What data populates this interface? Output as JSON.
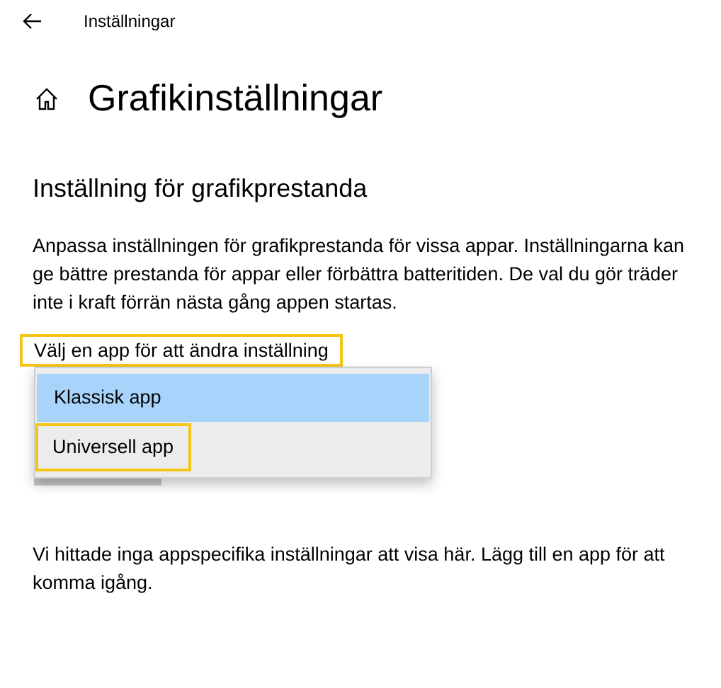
{
  "window": {
    "title": "Inställningar"
  },
  "page": {
    "title": "Grafikinställningar"
  },
  "section": {
    "title": "Inställning för grafikprestanda",
    "description": "Anpassa inställningen för grafikprestanda för vissa appar. Inställningarna kan ge bättre prestanda för appar eller förbättra batteritiden. De val du gör träder inte i kraft förrän nästa gång appen startas."
  },
  "app_type": {
    "label": "Välj en app för att ändra inställning",
    "highlighted": true,
    "options": [
      {
        "label": "Klassisk app",
        "selected": true,
        "highlighted": false
      },
      {
        "label": "Universell app",
        "selected": false,
        "highlighted": true
      }
    ]
  },
  "empty_message": "Vi hittade inga appspecifika inställningar att visa här. Lägg till en app för att komma igång."
}
